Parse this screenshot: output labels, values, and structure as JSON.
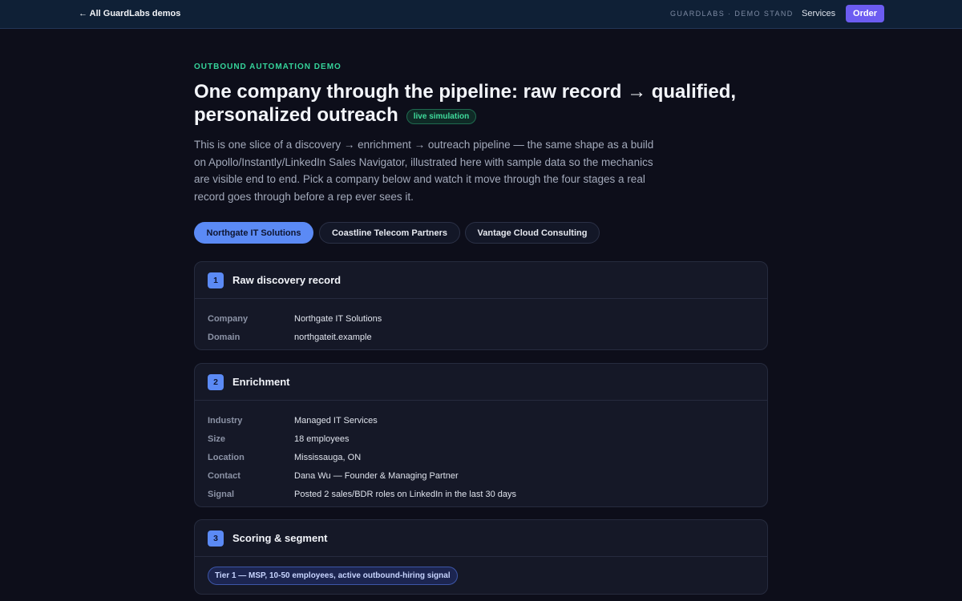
{
  "topbar": {
    "back_label": "← All GuardLabs demos",
    "brand_tag": "GUARDLABS · DEMO STAND",
    "services_label": "Services",
    "order_label": "Order",
    "order_color": "#6c5cf1"
  },
  "hero": {
    "eyebrow": "OUTBOUND AUTOMATION DEMO",
    "title": "One company through the pipeline: raw record → qualified, personalized outreach",
    "badge": "live simulation",
    "intro": "This is one slice of a discovery → enrichment → outreach pipeline — the same shape as a build on Apollo/Instantly/LinkedIn Sales Navigator, illustrated here with sample data so the mechanics are visible end to end. Pick a company below and watch it move through the four stages a real record goes through before a rep ever sees it."
  },
  "companies": {
    "items": [
      {
        "label": "Northgate IT Solutions",
        "selected": true
      },
      {
        "label": "Coastline Telecom Partners",
        "selected": false
      },
      {
        "label": "Vantage Cloud Consulting",
        "selected": false
      }
    ]
  },
  "stages": [
    {
      "number": "1",
      "title": "Raw discovery record",
      "rows": [
        {
          "label": "Company",
          "value": "Northgate IT Solutions"
        },
        {
          "label": "Domain",
          "value": "northgateit.example"
        }
      ]
    },
    {
      "number": "2",
      "title": "Enrichment",
      "rows": [
        {
          "label": "Industry",
          "value": "Managed IT Services"
        },
        {
          "label": "Size",
          "value": "18 employees"
        },
        {
          "label": "Location",
          "value": "Mississauga, ON"
        },
        {
          "label": "Contact",
          "value": "Dana Wu — Founder & Managing Partner"
        },
        {
          "label": "Signal",
          "value": "Posted 2 sales/BDR roles on LinkedIn in the last 30 days"
        }
      ]
    },
    {
      "number": "3",
      "title": "Scoring & segment",
      "tier": "Tier 1 — MSP, 10-50 employees, active outbound-hiring signal"
    }
  ],
  "colors": {
    "accent": "#5b8af5",
    "eyebrow": "#35d39a",
    "background": "#0d0e1a"
  }
}
